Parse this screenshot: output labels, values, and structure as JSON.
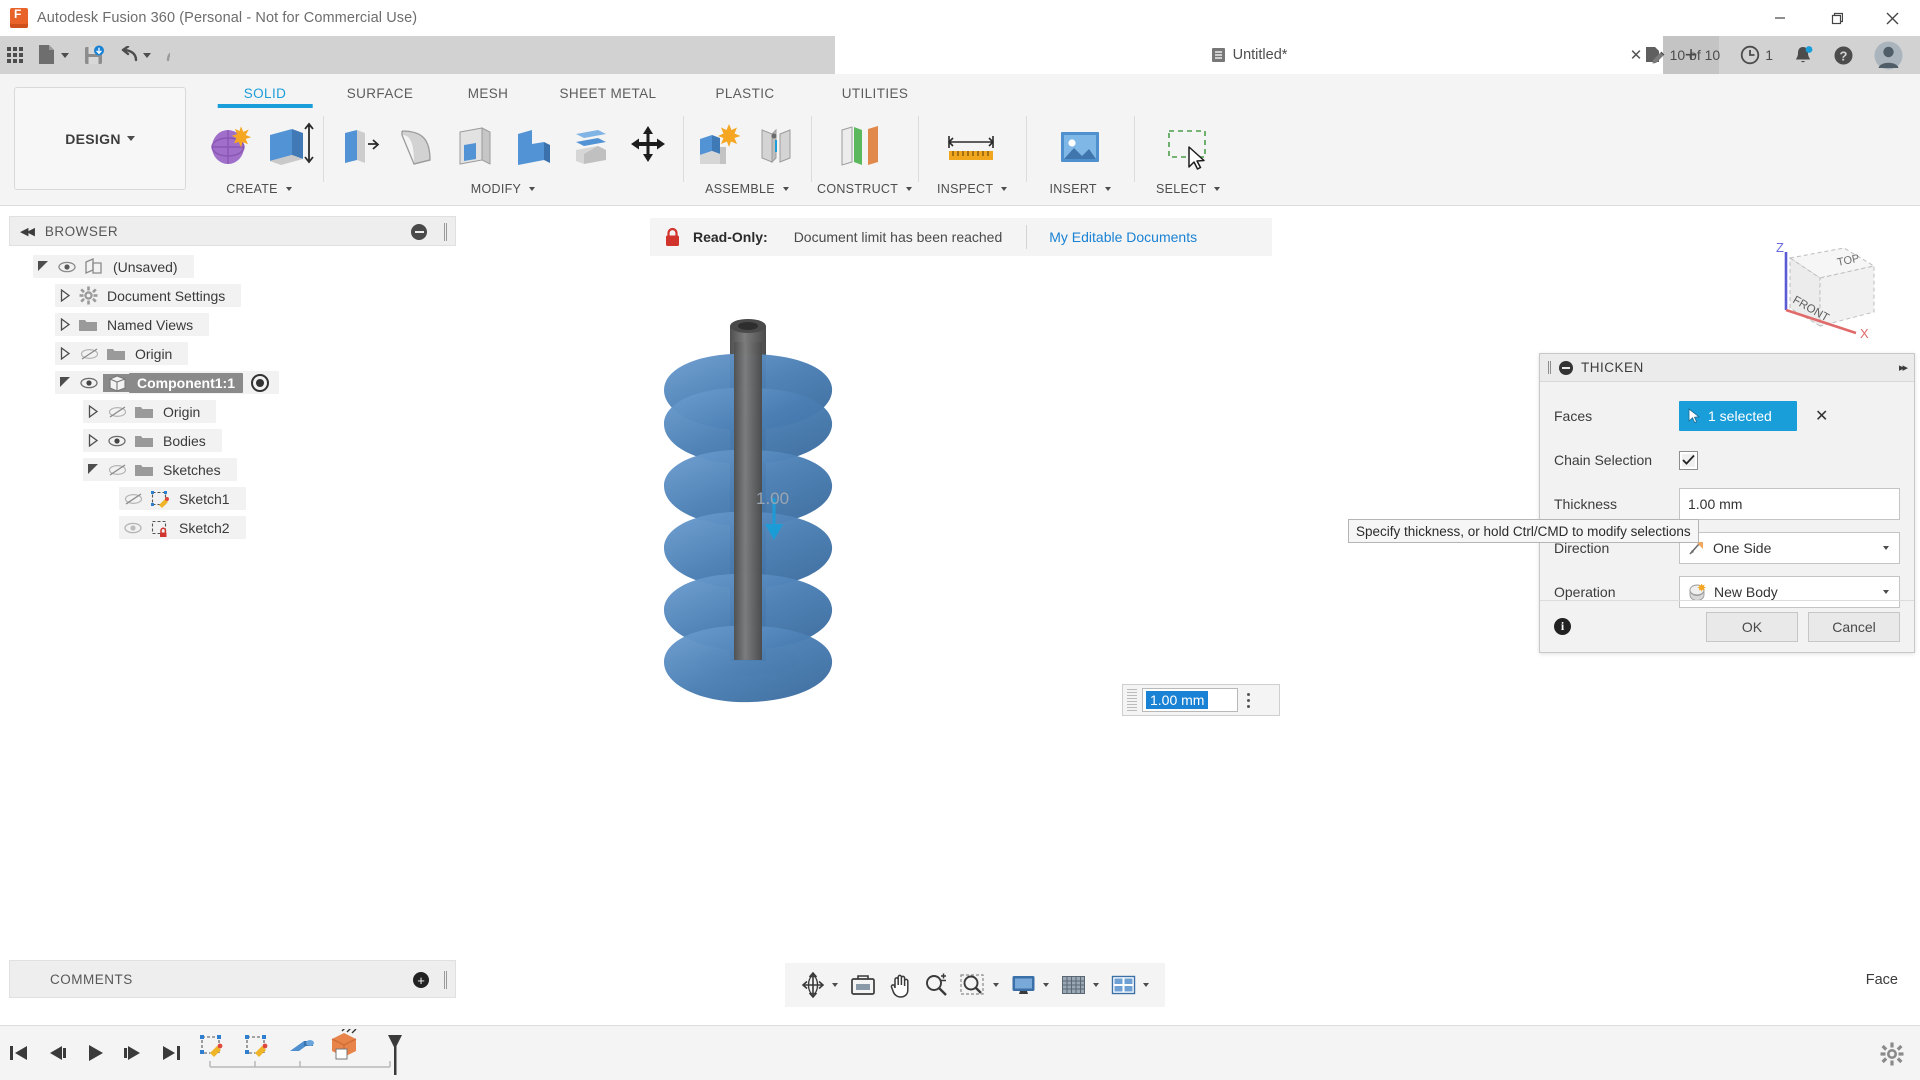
{
  "window": {
    "title": "Autodesk Fusion 360 (Personal - Not for Commercial Use)",
    "minimize_label": "Minimize",
    "maximize_label": "Restore",
    "close_label": "Close"
  },
  "appbar": {
    "grid_label": "show-all-apps",
    "new_label": "New",
    "save_label": "Save",
    "undo_label": "Undo",
    "redo_label": "Redo",
    "document_tab": "Untitled*",
    "new_tab_label": "+",
    "edits_count": "10 of 10",
    "history_count": "1",
    "notifications_label": "Notifications",
    "help_label": "Help",
    "account_label": "Account"
  },
  "ribbon": {
    "workspace": "DESIGN",
    "tabs": [
      {
        "label": "SOLID",
        "active": true
      },
      {
        "label": "SURFACE",
        "active": false
      },
      {
        "label": "MESH",
        "active": false
      },
      {
        "label": "SHEET METAL",
        "active": false
      },
      {
        "label": "PLASTIC",
        "active": false
      },
      {
        "label": "UTILITIES",
        "active": false
      }
    ],
    "groups": [
      {
        "label": "CREATE",
        "dropdown": true
      },
      {
        "label": "MODIFY",
        "dropdown": true
      },
      {
        "label": "ASSEMBLE",
        "dropdown": true
      },
      {
        "label": "CONSTRUCT",
        "dropdown": true
      },
      {
        "label": "INSPECT",
        "dropdown": true
      },
      {
        "label": "INSERT",
        "dropdown": true
      },
      {
        "label": "SELECT",
        "dropdown": true
      }
    ]
  },
  "browser": {
    "title": "BROWSER",
    "nodes": [
      {
        "label": "(Unsaved)",
        "indent": 0,
        "twisty": "down",
        "eye": "visible",
        "icon": "document-icon",
        "selected": false
      },
      {
        "label": "Document Settings",
        "indent": 1,
        "twisty": "right",
        "eye": "none",
        "icon": "gear-icon",
        "selected": false
      },
      {
        "label": "Named Views",
        "indent": 1,
        "twisty": "right",
        "eye": "none",
        "icon": "folder-icon",
        "selected": false
      },
      {
        "label": "Origin",
        "indent": 1,
        "twisty": "right",
        "eye": "hidden",
        "icon": "folder-icon",
        "selected": false
      },
      {
        "label": "Component1:1",
        "indent": 1,
        "twisty": "down",
        "eye": "visible",
        "icon": "component-icon",
        "selected": true
      },
      {
        "label": "Origin",
        "indent": 2,
        "twisty": "right",
        "eye": "hidden",
        "icon": "folder-icon",
        "selected": false
      },
      {
        "label": "Bodies",
        "indent": 2,
        "twisty": "right",
        "eye": "visible",
        "icon": "folder-icon",
        "selected": false
      },
      {
        "label": "Sketches",
        "indent": 2,
        "twisty": "down",
        "eye": "hidden",
        "icon": "folder-icon",
        "selected": false
      },
      {
        "label": "Sketch1",
        "indent": 3,
        "twisty": "none",
        "eye": "hidden",
        "icon": "sketch-icon",
        "selected": false
      },
      {
        "label": "Sketch2",
        "indent": 3,
        "twisty": "none",
        "eye": "visible",
        "icon": "sketch-locked-icon",
        "selected": false
      }
    ]
  },
  "comments": {
    "title": "COMMENTS",
    "add_label": "+"
  },
  "readonly_banner": {
    "prefix": "Read-Only:",
    "message": "Document limit has been reached",
    "link": "My Editable Documents"
  },
  "viewcube": {
    "top": "TOP",
    "front": "FRONT",
    "axis_z": "Z",
    "axis_x": "X"
  },
  "canvas_value": {
    "value": "1.00 mm"
  },
  "dialog": {
    "title": "THICKEN",
    "faces_label": "Faces",
    "faces_value": "1 selected",
    "chain_label": "Chain Selection",
    "chain_checked": true,
    "thickness_label": "Thickness",
    "thickness_value": "1.00 mm",
    "direction_label": "Direction",
    "direction_value": "One Side",
    "operation_label": "Operation",
    "operation_value": "New Body",
    "ok_label": "OK",
    "cancel_label": "Cancel"
  },
  "tooltip": {
    "text": "Specify thickness, or hold Ctrl/CMD to modify selections"
  },
  "navbar": {
    "items": [
      {
        "name": "orbit-icon",
        "dropdown": true
      },
      {
        "name": "look-at-icon",
        "dropdown": false
      },
      {
        "name": "pan-hand-icon",
        "dropdown": false
      },
      {
        "name": "zoom-icon",
        "dropdown": false
      },
      {
        "name": "zoom-window-icon",
        "dropdown": true
      },
      {
        "name": "display-settings-icon",
        "dropdown": true
      },
      {
        "name": "grid-snaps-icon",
        "dropdown": true
      },
      {
        "name": "viewports-icon",
        "dropdown": true
      }
    ]
  },
  "status": {
    "selection_filter": "Face"
  },
  "timeline": {
    "buttons": [
      "go-to-beginning",
      "step-back",
      "play",
      "step-forward",
      "go-to-end"
    ],
    "features": [
      "sketch-icon",
      "sketch-icon",
      "extrude-icon",
      "component-icon"
    ],
    "settings_label": "Timeline settings"
  },
  "colors": {
    "accent": "#1a9ed9",
    "link": "#1a82d4",
    "selection": "#1a82d4",
    "brand": "#e8622a",
    "model_blue": "#4a7fb5",
    "model_gray": "#6b6b6b"
  }
}
